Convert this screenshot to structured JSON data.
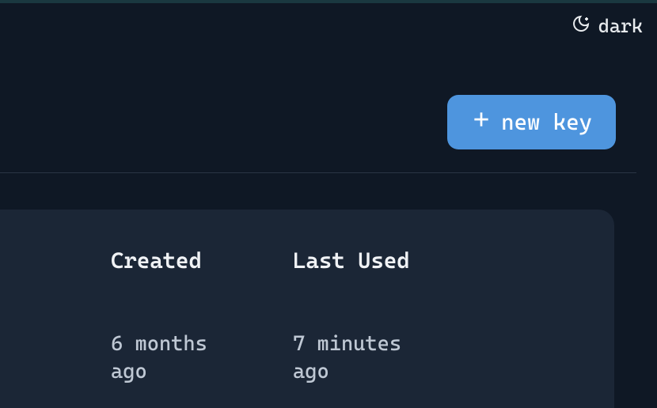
{
  "theme": {
    "label": "dark"
  },
  "actions": {
    "new_key_label": "new key"
  },
  "table": {
    "headers": {
      "created": "Created",
      "last_used": "Last Used"
    },
    "row": {
      "created": "6 months ago",
      "last_used": "7 minutes ago"
    }
  }
}
